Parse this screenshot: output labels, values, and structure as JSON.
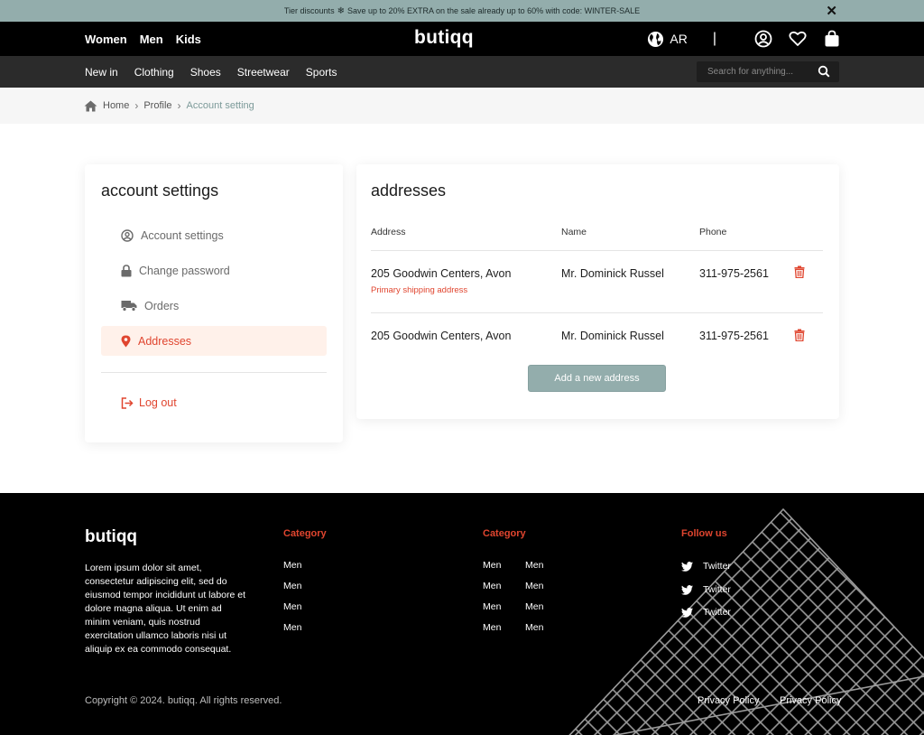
{
  "banner": {
    "lead": "Tier discounts",
    "text": "Save up to 20% EXTRA on the sale already up to 60% with code: WINTER-SALE",
    "icon": "snowflake-icon"
  },
  "header": {
    "gender_links": [
      "Women",
      "Men",
      "Kids"
    ],
    "logo": "butiqq",
    "language": "AR",
    "separator": "|",
    "icons": [
      "globe-icon",
      "user-icon",
      "heart-icon",
      "bag-icon"
    ]
  },
  "category_nav": {
    "links": [
      "New in",
      "Clothing",
      "Shoes",
      "Streetwear",
      "Sports"
    ],
    "search_placeholder": "Search for anything..."
  },
  "breadcrumb": {
    "items": [
      "Home",
      "Profile"
    ],
    "current": "Account setting"
  },
  "sidebar": {
    "title": "account settings",
    "items": [
      {
        "label": "Account settings",
        "icon": "user-circle-icon",
        "active": false
      },
      {
        "label": "Change password",
        "icon": "lock-icon",
        "active": false
      },
      {
        "label": "Orders",
        "icon": "truck-icon",
        "active": false
      },
      {
        "label": "Addresses",
        "icon": "location-pin-icon",
        "active": true
      }
    ],
    "logout_label": "Log out"
  },
  "addresses": {
    "title": "addresses",
    "columns": [
      "Address",
      "Name",
      "Phone"
    ],
    "rows": [
      {
        "address": "205 Goodwin Centers, Avon",
        "name": "Mr. Dominick Russel",
        "phone": "311-975-2561",
        "note": "Primary shipping address"
      },
      {
        "address": "205 Goodwin Centers, Avon",
        "name": "Mr. Dominick Russel",
        "phone": "311-975-2561",
        "note": ""
      }
    ],
    "add_button": "Add a new address"
  },
  "footer": {
    "logo": "butiqq",
    "description": "Lorem ipsum dolor sit amet, consectetur adipiscing elit, sed do eiusmod tempor incididunt ut labore et dolore magna aliqua. Ut enim ad minim veniam, quis nostrud exercitation ullamco laboris nisi ut aliquip ex ea commodo consequat.",
    "col1": {
      "heading": "Category",
      "links": [
        "Men",
        "Men",
        "Men",
        "Men"
      ]
    },
    "col2": {
      "heading": "Category",
      "links_a": [
        "Men",
        "Men",
        "Men",
        "Men"
      ],
      "links_b": [
        "Men",
        "Men",
        "Men",
        "Men"
      ]
    },
    "follow": {
      "heading": "Follow us",
      "links": [
        "Twitter",
        "Twitter",
        "Twitter"
      ]
    },
    "copyright": "Copyright © 2024. butiqq. All rights reserved.",
    "policies": [
      "Privacy Policy",
      "Privacy Policy"
    ]
  },
  "colors": {
    "accent": "#93adac",
    "brand_red": "#e0452f",
    "header_bg": "#000000",
    "subnav_bg": "#2b2b2b"
  }
}
